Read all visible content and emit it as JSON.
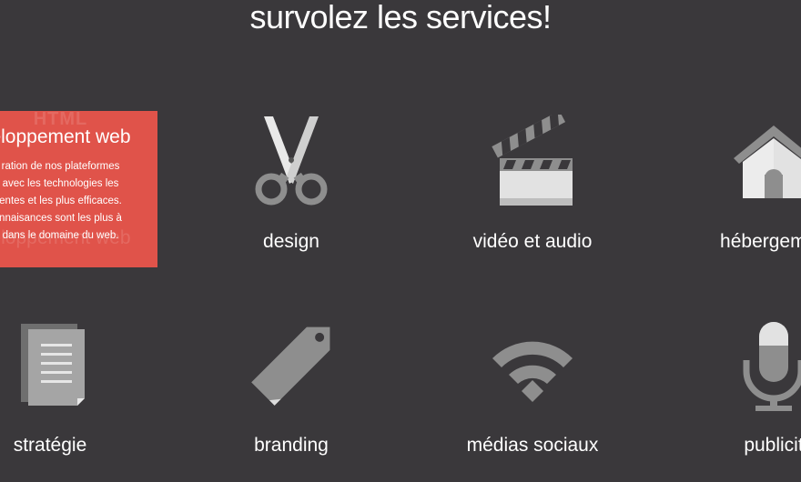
{
  "heading": "survolez les services!",
  "hover_card": {
    "ghost_label": "HTML",
    "title": "eloppement web",
    "text": "ration de nos plateformes\navec les technologies les\nentes et les plus efficaces.\nnnaisances sont les plus à\ndans le domaine du web.",
    "ghost_caption": "eloppement web",
    "color": "#e0534a"
  },
  "services": [
    {
      "label": "design",
      "icon": "scissors-icon"
    },
    {
      "label": "vidéo et audio",
      "icon": "clapperboard-icon"
    },
    {
      "label": "hébergemen",
      "icon": "house-icon"
    },
    {
      "label": "stratégie",
      "icon": "document-icon"
    },
    {
      "label": "branding",
      "icon": "tag-icon"
    },
    {
      "label": "médias sociaux",
      "icon": "wifi-icon"
    },
    {
      "label": "publicit",
      "icon": "microphone-icon"
    }
  ],
  "colors": {
    "background": "#3a383b",
    "icon_gray": "#8e8e8e",
    "icon_light": "#d8d8d8"
  }
}
